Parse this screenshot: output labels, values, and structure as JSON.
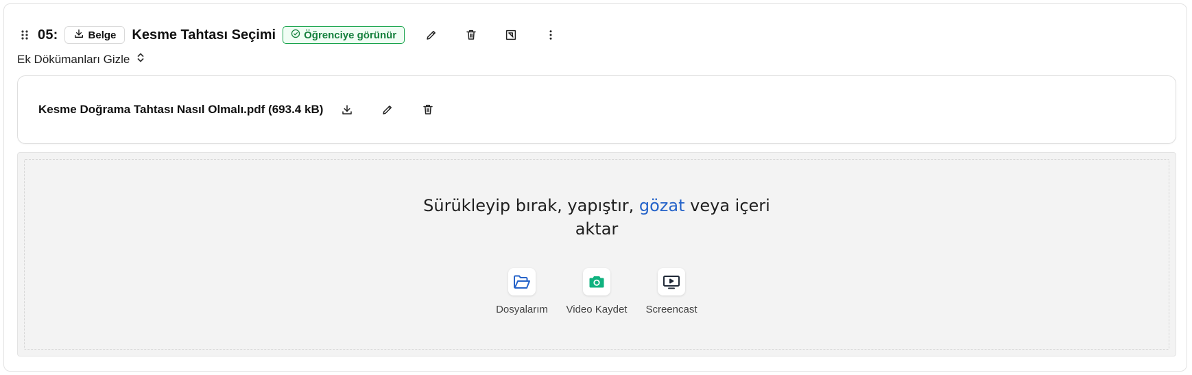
{
  "header": {
    "number": "05:",
    "type_label": "Belge",
    "title": "Kesme Tahtası Seçimi",
    "visibility_badge": "Öğrenciye görünür"
  },
  "attachments": {
    "toggle_label": "Ek Dökümanları Gizle",
    "files": [
      {
        "name": "Kesme Doğrama Tahtası Nasıl Olmalı.pdf (693.4 kB)"
      }
    ]
  },
  "dropzone": {
    "text_before": "Sürükleyip bırak, yapıştır, ",
    "browse_link": "gözat",
    "text_after_line1": " veya içeri",
    "text_line2": "aktar",
    "sources": [
      {
        "label": "Dosyalarım",
        "icon": "folder-icon",
        "color": "#2563c9"
      },
      {
        "label": "Video Kaydet",
        "icon": "camera-icon",
        "color": "#10b27f"
      },
      {
        "label": "Screencast",
        "icon": "screencast-icon",
        "color": "#1f2937"
      }
    ]
  },
  "colors": {
    "badge_green": "#16a34a",
    "link_blue": "#2563c9",
    "dropzone_bg": "#f3f3f3"
  }
}
